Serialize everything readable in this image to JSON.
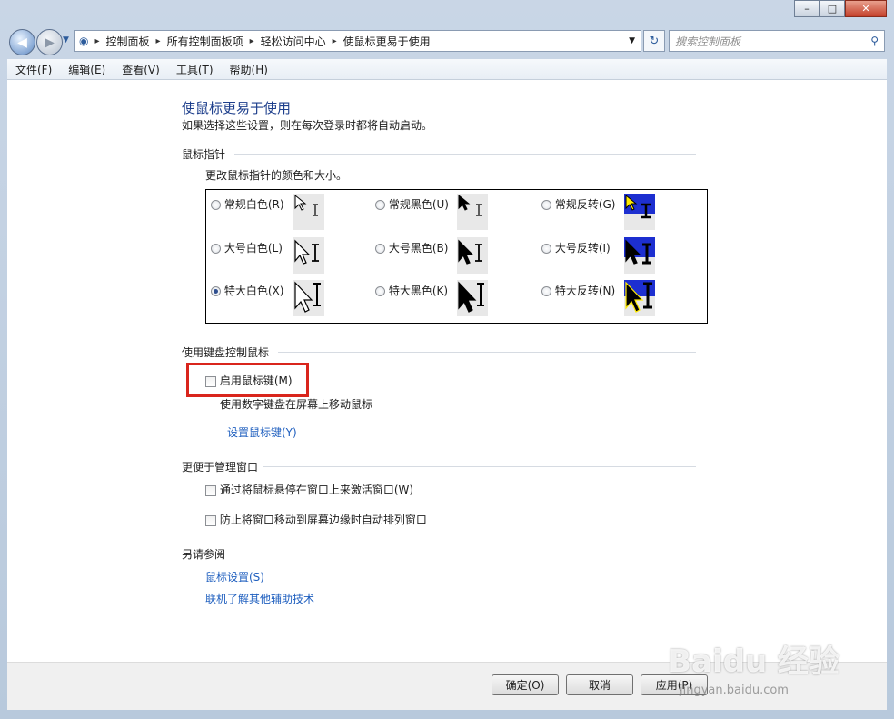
{
  "window": {
    "caption": {
      "minimize": "–",
      "maximize": "□",
      "close": "✕"
    }
  },
  "nav": {
    "back_icon": "back-arrow-icon",
    "forward_icon": "forward-arrow-icon",
    "breadcrumbs": [
      "控制面板",
      "所有控制面板项",
      "轻松访问中心",
      "使鼠标更易于使用"
    ],
    "search_placeholder": "搜索控制面板"
  },
  "menu": [
    "文件(F)",
    "编辑(E)",
    "查看(V)",
    "工具(T)",
    "帮助(H)"
  ],
  "page": {
    "title": "使鼠标更易于使用",
    "subtitle": "如果选择这些设置，则在每次登录时都将自动启动。"
  },
  "pointer_section": {
    "heading": "鼠标指针",
    "desc": "更改鼠标指针的颜色和大小。",
    "options": [
      {
        "label": "常规白色(R)",
        "selected": false,
        "style": "white",
        "size": "regular"
      },
      {
        "label": "常规黑色(U)",
        "selected": false,
        "style": "black",
        "size": "regular"
      },
      {
        "label": "常规反转(G)",
        "selected": false,
        "style": "inverted",
        "size": "regular"
      },
      {
        "label": "大号白色(L)",
        "selected": false,
        "style": "white",
        "size": "large"
      },
      {
        "label": "大号黑色(B)",
        "selected": false,
        "style": "black",
        "size": "large"
      },
      {
        "label": "大号反转(I)",
        "selected": false,
        "style": "inverted",
        "size": "large"
      },
      {
        "label": "特大白色(X)",
        "selected": true,
        "style": "white",
        "size": "xlarge"
      },
      {
        "label": "特大黑色(K)",
        "selected": false,
        "style": "black",
        "size": "xlarge"
      },
      {
        "label": "特大反转(N)",
        "selected": false,
        "style": "inverted",
        "size": "xlarge"
      }
    ]
  },
  "keyboard_section": {
    "heading": "使用键盘控制鼠标",
    "checkbox_label": "启用鼠标键(M)",
    "checked": false,
    "desc": "使用数字键盘在屏幕上移动鼠标",
    "link": "设置鼠标键(Y)"
  },
  "window_section": {
    "heading": "更便于管理窗口",
    "options": [
      {
        "label": "通过将鼠标悬停在窗口上来激活窗口(W)",
        "checked": false
      },
      {
        "label": "防止将窗口移动到屏幕边缘时自动排列窗口",
        "checked": false
      }
    ]
  },
  "see_also": {
    "heading": "另请参阅",
    "links": [
      "鼠标设置(S)",
      "联机了解其他辅助技术"
    ]
  },
  "buttons": {
    "ok": "确定(O)",
    "cancel": "取消",
    "apply": "应用(P)"
  },
  "watermark": "Baidu 经验",
  "watermark_sub": "jingyan.baidu.com",
  "colors": {
    "accent": "#1e3f8c",
    "link": "#1f5fbf",
    "highlight": "#d9251c",
    "inverted_bg": "#1d2fd0"
  }
}
